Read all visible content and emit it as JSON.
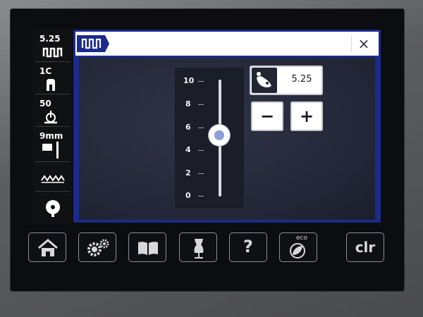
{
  "sidebar": {
    "items": [
      {
        "value": "5.25",
        "icon": "stitch-width-icon"
      },
      {
        "value": "1C",
        "icon": "presser-foot-icon"
      },
      {
        "value": "50",
        "icon": "thread-tension-icon"
      },
      {
        "value": "9mm",
        "icon": "needle-plate-icon"
      },
      {
        "value": "",
        "icon": "feed-dog-icon"
      },
      {
        "value": "",
        "icon": "bobbin-icon"
      }
    ]
  },
  "dialog": {
    "title_icon": "stitch-width-icon",
    "close_label": "×"
  },
  "slider": {
    "ticks": [
      "10",
      "8",
      "6",
      "4",
      "2",
      "0"
    ],
    "min": 0,
    "max": 10,
    "value": 5.25
  },
  "value_field": {
    "icon": "stitch-width-adjust-icon",
    "value": "5.25"
  },
  "buttons": {
    "minus": "−",
    "plus": "+"
  },
  "bottom_bar": {
    "home": "home-icon",
    "settings": "settings-icon",
    "guide": "book-icon",
    "tutorial": "dress-form-icon",
    "help_label": "?",
    "eco_label": "eco",
    "clr_label": "clr"
  },
  "colors": {
    "accent": "#1b2a8c",
    "panel": "#232636"
  }
}
